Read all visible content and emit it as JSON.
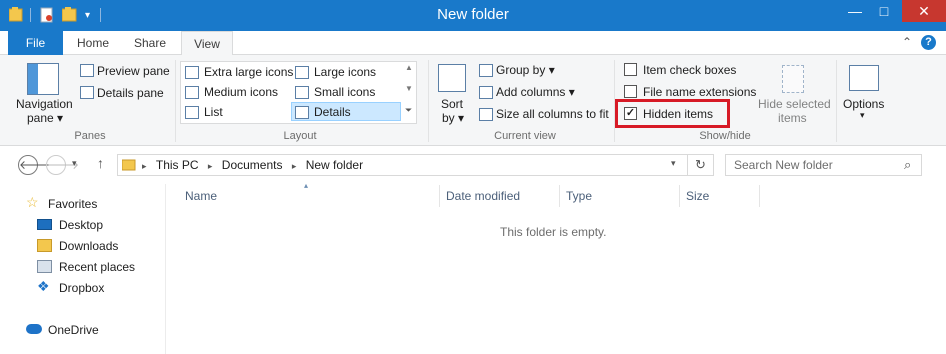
{
  "window": {
    "title": "New folder",
    "controls": {
      "minimize": "—",
      "maximize": "□",
      "close": "✕"
    },
    "accent_color": "#1979ca"
  },
  "ribbon_tabs": [
    "File",
    "Home",
    "Share",
    "View"
  ],
  "active_tab": "View",
  "ribbon": {
    "panes": {
      "navigation_pane_label": "Navigation",
      "navigation_pane_label2": "pane",
      "preview_pane": "Preview pane",
      "details_pane": "Details pane",
      "group_label": "Panes"
    },
    "layout": {
      "items": [
        "Extra large icons",
        "Large icons",
        "Medium icons",
        "Small icons",
        "List",
        "Details"
      ],
      "selected": "Details",
      "group_label": "Layout"
    },
    "current_view": {
      "sort_by_label": "Sort",
      "sort_by_label2": "by",
      "group_by": "Group by",
      "add_columns": "Add columns",
      "size_all_columns": "Size all columns to fit",
      "group_label": "Current view"
    },
    "show_hide": {
      "item_check_boxes": {
        "label": "Item check boxes",
        "checked": false
      },
      "file_name_extensions": {
        "label": "File name extensions",
        "checked": false
      },
      "hidden_items": {
        "label": "Hidden items",
        "checked": true
      },
      "hide_selected_label": "Hide selected",
      "hide_selected_label2": "items",
      "group_label": "Show/hide",
      "highlight_color": "#d71a26"
    },
    "options_label": "Options"
  },
  "address_bar": {
    "breadcrumbs": [
      "This PC",
      "Documents",
      "New folder"
    ],
    "search_placeholder": "Search New folder"
  },
  "nav_pane": {
    "items": [
      {
        "label": "Favorites",
        "icon": "star-icon"
      },
      {
        "label": "Desktop",
        "icon": "desktop-icon"
      },
      {
        "label": "Downloads",
        "icon": "downloads-folder-icon"
      },
      {
        "label": "Recent places",
        "icon": "recent-places-icon"
      },
      {
        "label": "Dropbox",
        "icon": "dropbox-icon"
      },
      {
        "label": "OneDrive",
        "icon": "onedrive-icon"
      }
    ]
  },
  "content": {
    "columns": [
      "Name",
      "Date modified",
      "Type",
      "Size"
    ],
    "empty_message": "This folder is empty."
  }
}
